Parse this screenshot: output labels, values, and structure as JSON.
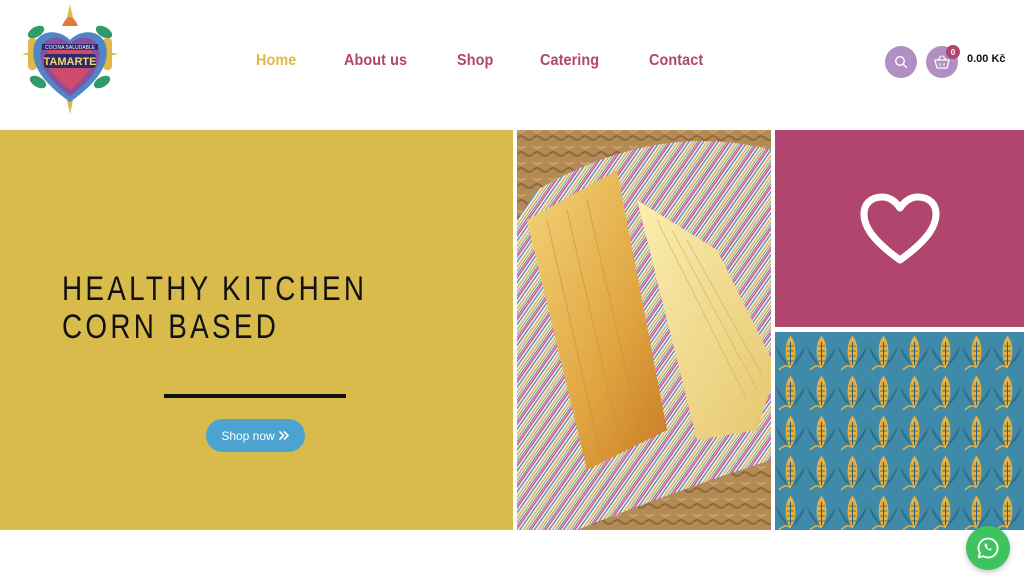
{
  "brand": {
    "logo_text": "TAMARTE",
    "logo_subtext": "COCINA SALUDABLE"
  },
  "nav": {
    "items": [
      {
        "label": "Home",
        "active": true
      },
      {
        "label": "About us",
        "active": false
      },
      {
        "label": "Shop",
        "active": false
      },
      {
        "label": "Catering",
        "active": false
      },
      {
        "label": "Contact",
        "active": false
      }
    ]
  },
  "header_actions": {
    "search_icon": "search-icon",
    "cart_icon": "basket-icon",
    "cart_count": "0",
    "cart_total": "0.00 Kč"
  },
  "hero": {
    "title": "HEALTHY KITCHEN\nCORN BASED",
    "button_label": "Shop now",
    "button_icon": "double-chevron-right-icon"
  },
  "tiles": {
    "heart_icon": "heart-icon",
    "photo_alt": "tamales on striped cloth",
    "pattern": "corn-pattern"
  },
  "colors": {
    "nav": "#b0456e",
    "nav_active": "#e0b84a",
    "hero_bg": "#d9bb4c",
    "heart_bg": "#b0456e",
    "button": "#4da3cf",
    "header_icon_bg": "#b08fc3",
    "whatsapp": "#3fc35f"
  }
}
